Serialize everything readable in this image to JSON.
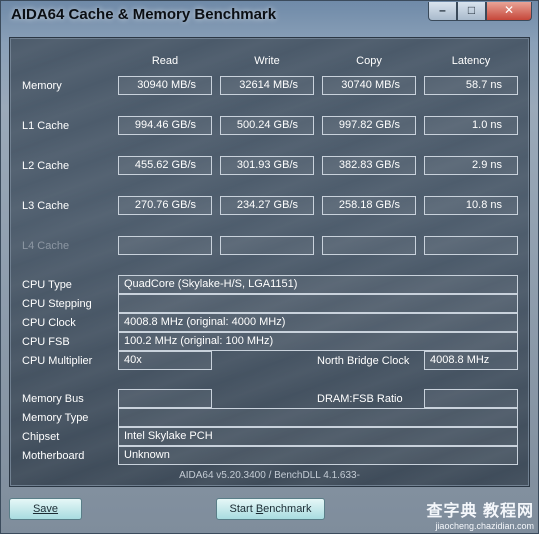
{
  "window": {
    "title": "AIDA64 Cache & Memory Benchmark",
    "buttons": [
      "–",
      "□",
      "✕"
    ]
  },
  "columns": [
    "Read",
    "Write",
    "Copy",
    "Latency"
  ],
  "rows": [
    {
      "label": "Memory",
      "read": "30940 MB/s",
      "write": "32614 MB/s",
      "copy": "30740 MB/s",
      "latency": "58.7 ns"
    },
    {
      "label": "L1 Cache",
      "read": "994.46 GB/s",
      "write": "500.24 GB/s",
      "copy": "997.82 GB/s",
      "latency": "1.0 ns"
    },
    {
      "label": "L2 Cache",
      "read": "455.62 GB/s",
      "write": "301.93 GB/s",
      "copy": "382.83 GB/s",
      "latency": "2.9 ns"
    },
    {
      "label": "L3 Cache",
      "read": "270.76 GB/s",
      "write": "234.27 GB/s",
      "copy": "258.18 GB/s",
      "latency": "10.8 ns"
    },
    {
      "label": "L4 Cache",
      "read": "",
      "write": "",
      "copy": "",
      "latency": ""
    }
  ],
  "info": {
    "cpu_type_label": "CPU Type",
    "cpu_type": "QuadCore   (Skylake-H/S, LGA1151)",
    "cpu_stepping_label": "CPU Stepping",
    "cpu_stepping": "",
    "cpu_clock_label": "CPU Clock",
    "cpu_clock": "4008.8 MHz  (original: 4000 MHz)",
    "cpu_fsb_label": "CPU FSB",
    "cpu_fsb": "100.2 MHz  (original: 100 MHz)",
    "cpu_multiplier_label": "CPU Multiplier",
    "cpu_multiplier": "40x",
    "nb_clock_label": "North Bridge Clock",
    "nb_clock": "4008.8 MHz",
    "memory_bus_label": "Memory Bus",
    "memory_bus": "",
    "dram_fsb_label": "DRAM:FSB Ratio",
    "dram_fsb": "",
    "memory_type_label": "Memory Type",
    "memory_type": "",
    "chipset_label": "Chipset",
    "chipset": "Intel Skylake PCH",
    "motherboard_label": "Motherboard",
    "motherboard": "Unknown"
  },
  "footer": "AIDA64 v5.20.3400 / BenchDLL 4.1.633-",
  "buttons": {
    "save": "Save",
    "start_pre": "Start ",
    "start_key": "B",
    "start_post": "enchmark"
  },
  "watermark": {
    "big": "查字典 教程网",
    "small": "jiaocheng.chazidian.com"
  }
}
